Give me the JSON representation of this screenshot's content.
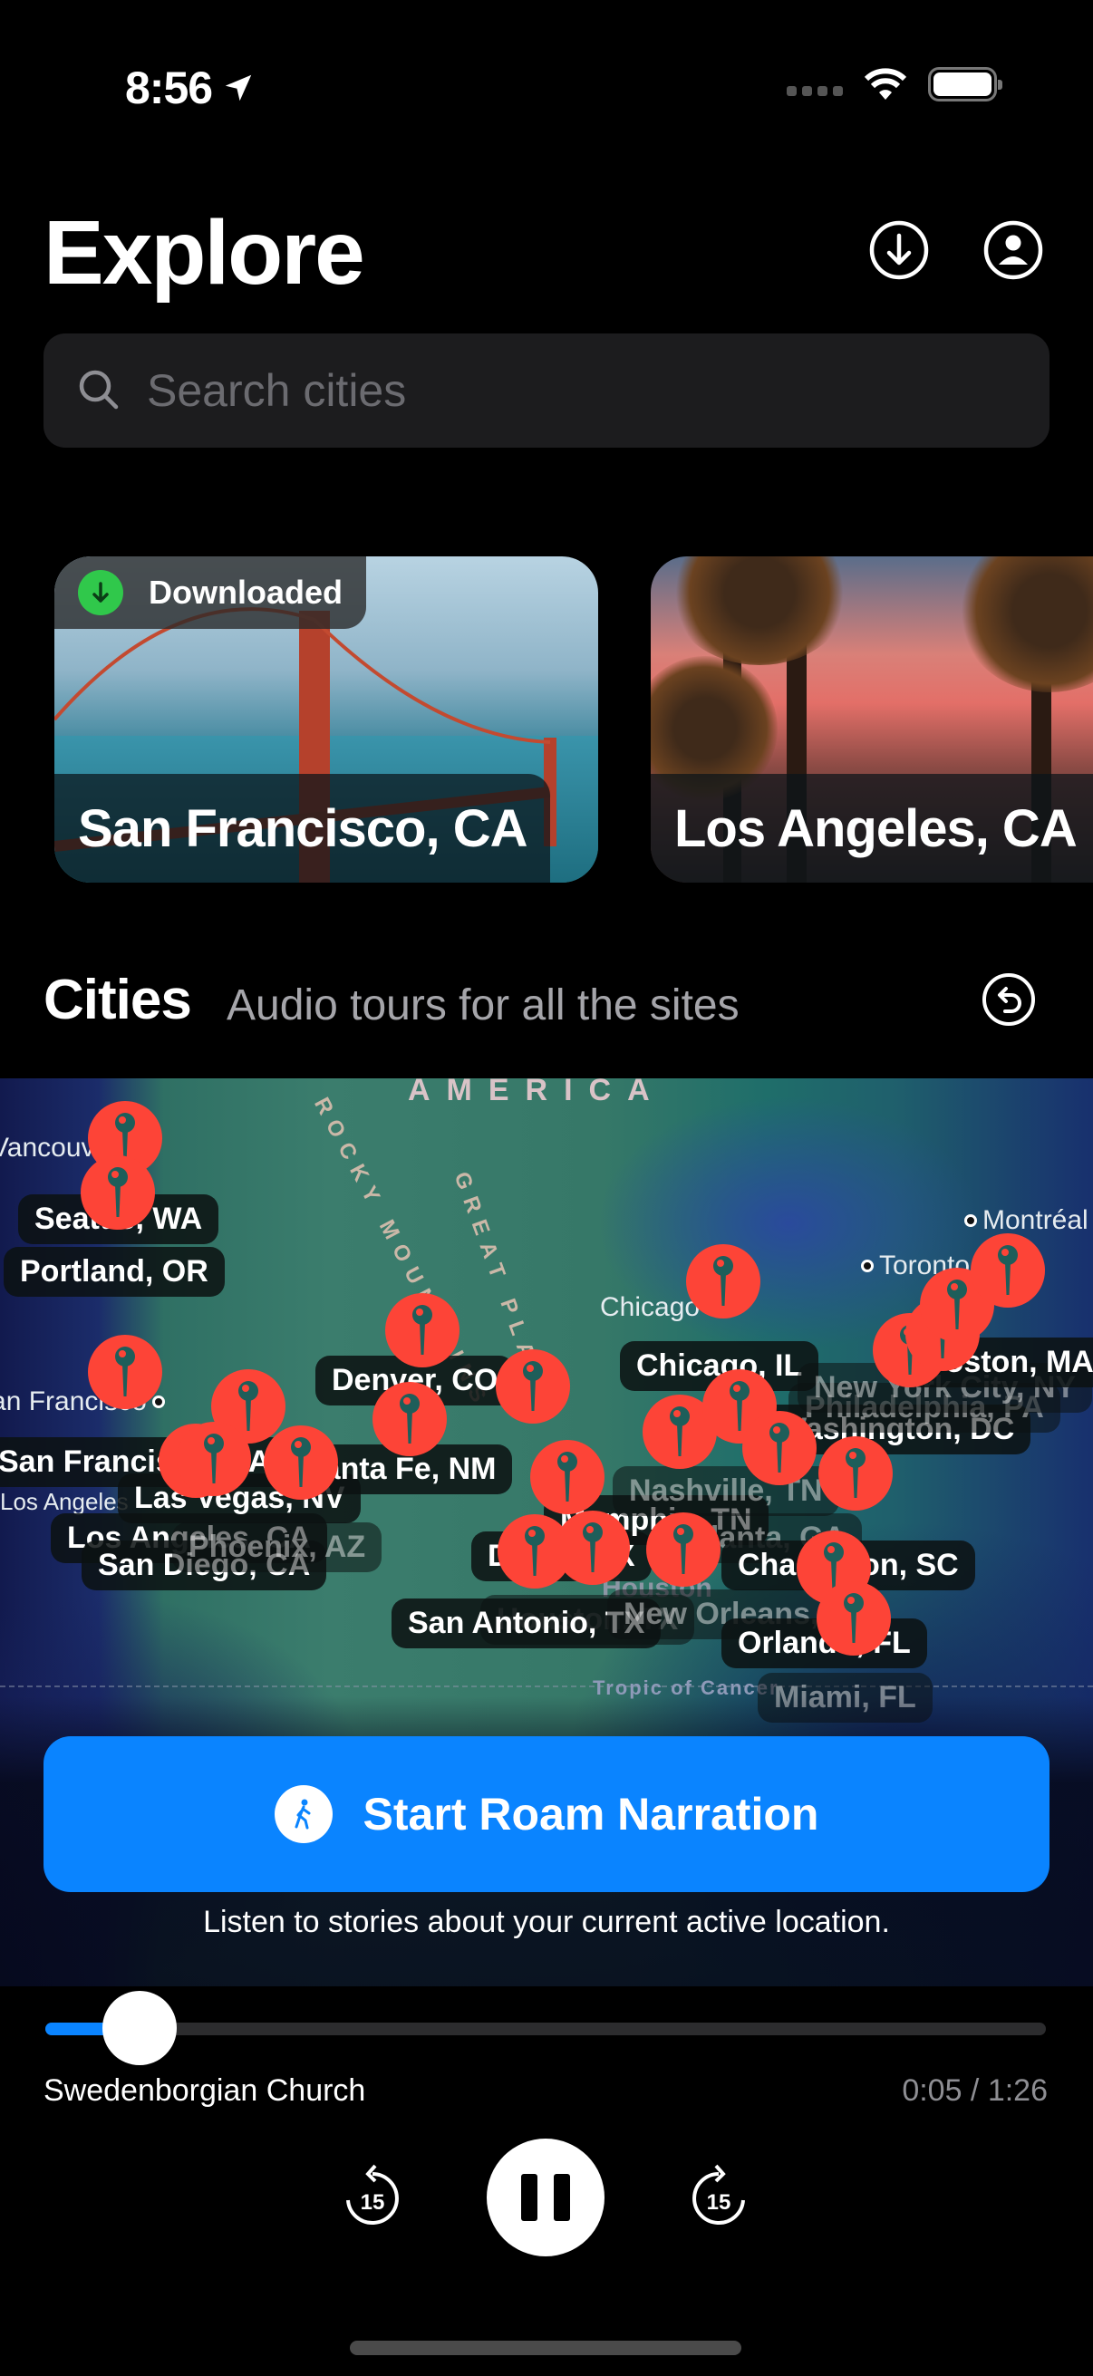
{
  "status_bar": {
    "time": "8:56",
    "icons": [
      "location-arrow-icon",
      "cellular-signal-icon",
      "wifi-icon",
      "battery-icon"
    ]
  },
  "header": {
    "title": "Explore",
    "icons": [
      "download-circle-icon",
      "profile-icon"
    ]
  },
  "search": {
    "placeholder": "Search cities",
    "value": ""
  },
  "featured_cities": [
    {
      "name": "San Francisco, CA",
      "badge": "Downloaded",
      "downloaded": true
    },
    {
      "name": "Los Angeles, CA",
      "badge": null,
      "downloaded": false
    }
  ],
  "cities_section": {
    "title": "Cities",
    "subtitle": "Audio tours for all the sites",
    "reset_icon": "reset-rotation-icon"
  },
  "map": {
    "region_labels": [
      "AMERICA",
      "ROCKY MOUNTAINS",
      "GREAT PLAINS"
    ],
    "base_places": [
      "Vancouver",
      "San Francisco",
      "Los Angeles",
      "Chicago",
      "Toronto",
      "Montréal",
      "Houston",
      "Tropic of Cancer"
    ],
    "city_labels": [
      {
        "name": "Seattle, WA"
      },
      {
        "name": "Portland, OR"
      },
      {
        "name": "San Francisco, CA"
      },
      {
        "name": "Los Angeles, CA"
      },
      {
        "name": "San Diego, CA"
      },
      {
        "name": "Las Vegas, NV"
      },
      {
        "name": "Phoenix, AZ"
      },
      {
        "name": "Santa Fe, NM"
      },
      {
        "name": "Denver, CO"
      },
      {
        "name": "Dallas, TX"
      },
      {
        "name": "Houston, TX"
      },
      {
        "name": "San Antonio, TX"
      },
      {
        "name": "New Orleans, LA"
      },
      {
        "name": "Memphis, TN"
      },
      {
        "name": "Nashville, TN"
      },
      {
        "name": "Atlanta, GA"
      },
      {
        "name": "Chicago, IL"
      },
      {
        "name": "Charleston, SC"
      },
      {
        "name": "Orlando, FL"
      },
      {
        "name": "Miami, FL"
      },
      {
        "name": "Washington, DC"
      },
      {
        "name": "Philadelphia, PA"
      },
      {
        "name": "New York City, NY"
      },
      {
        "name": "Boston, MA"
      }
    ],
    "pin_color": "#fd4437"
  },
  "roam": {
    "button_label": "Start Roam Narration",
    "hint": "Listen to stories about your current active location.",
    "accent": "#0a84ff"
  },
  "player": {
    "track_title": "Swedenborgian Church",
    "time_display": "0:05 / 1:26",
    "elapsed_seconds": 5,
    "duration_seconds": 86,
    "progress": 0.058,
    "skip_back_seconds": "15",
    "skip_forward_seconds": "15",
    "state": "playing"
  }
}
